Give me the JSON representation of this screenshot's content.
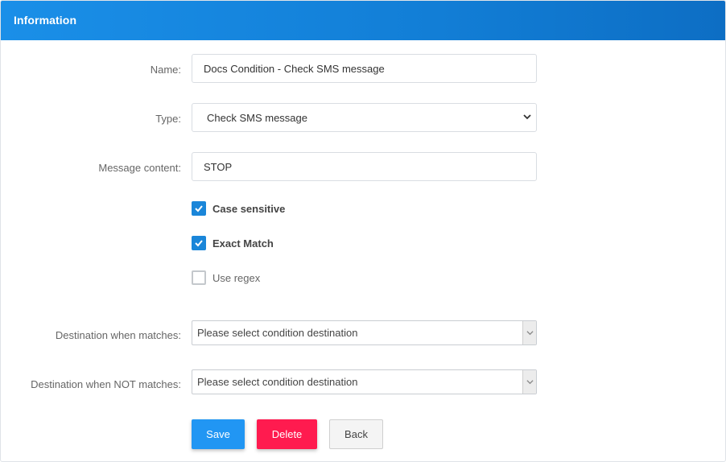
{
  "panel": {
    "title": "Information",
    "header_color": "#1a8fe8"
  },
  "form": {
    "name": {
      "label": "Name:",
      "value": "Docs Condition - Check SMS message"
    },
    "type": {
      "label": "Type:",
      "value": "Check SMS message",
      "icon": "chevron-down-icon"
    },
    "message_content": {
      "label": "Message content:",
      "value": "STOP"
    },
    "case_sensitive": {
      "label": "Case sensitive",
      "checked": true
    },
    "exact_match": {
      "label": "Exact Match",
      "checked": true
    },
    "use_regex": {
      "label": "Use regex",
      "checked": false
    },
    "dest_match": {
      "label": "Destination when matches:",
      "placeholder": "Please select condition destination"
    },
    "dest_not_match": {
      "label": "Destination when NOT matches:",
      "placeholder": "Please select condition destination"
    }
  },
  "buttons": {
    "save": "Save",
    "delete": "Delete",
    "back": "Back"
  },
  "colors": {
    "primary": "#2196f3",
    "danger": "#ff1b4f",
    "checkbox": "#1a86d9"
  }
}
